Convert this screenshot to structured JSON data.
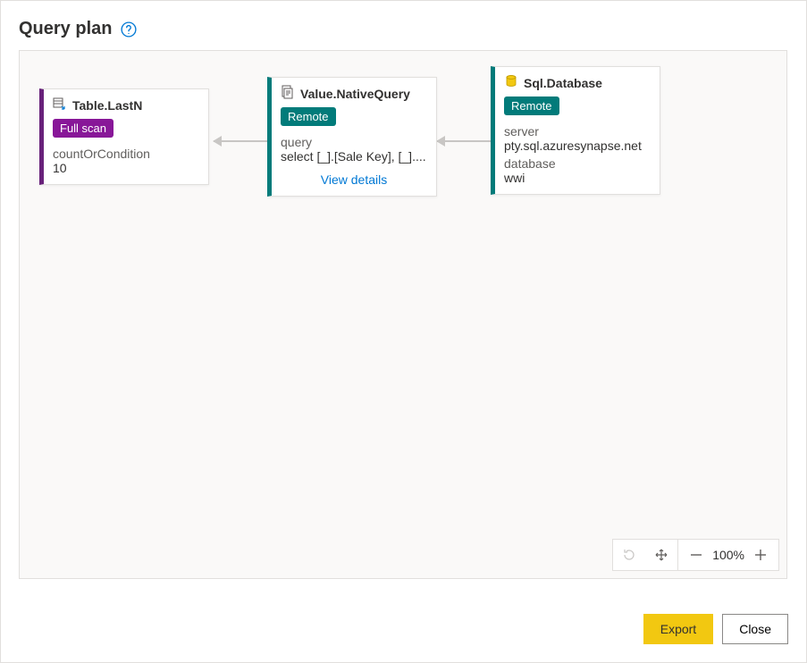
{
  "header": {
    "title": "Query plan"
  },
  "nodes": {
    "sql": {
      "title": "Sql.Database",
      "badge": "Remote",
      "server_label": "server",
      "server_value": "pty.sql.azuresynapse.net",
      "database_label": "database",
      "database_value": "wwi"
    },
    "native": {
      "title": "Value.NativeQuery",
      "badge": "Remote",
      "query_label": "query",
      "query_value": "select [_].[Sale Key], [_]....",
      "view_details": "View details"
    },
    "lastn": {
      "title": "Table.LastN",
      "badge": "Full scan",
      "field_label": "countOrCondition",
      "field_value": "10"
    }
  },
  "zoom": {
    "level": "100%"
  },
  "footer": {
    "export": "Export",
    "close": "Close"
  }
}
